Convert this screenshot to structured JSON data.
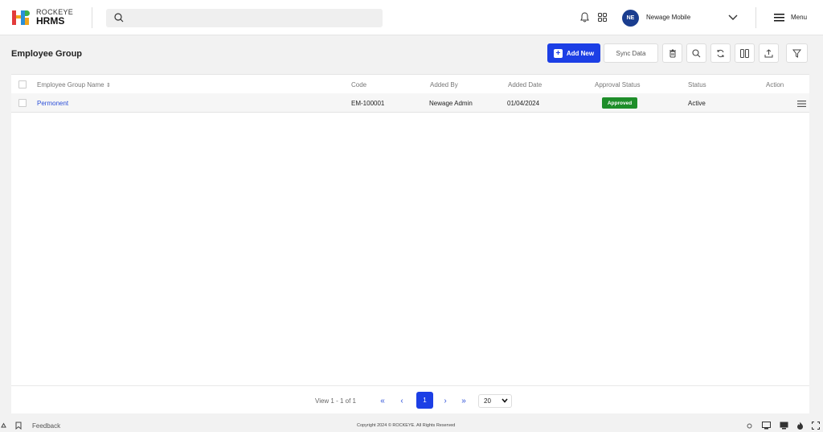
{
  "app": {
    "logo_top": "ROCKEYE",
    "logo_bottom": "HRMS"
  },
  "search": {
    "placeholder": "",
    "value": ""
  },
  "user": {
    "initials": "NE",
    "name": "Newage Mobile"
  },
  "menu": {
    "label": "Menu"
  },
  "page": {
    "title": "Employee Group",
    "add_new_label": "Add New",
    "sync_label": "Sync Data"
  },
  "table": {
    "columns": [
      "Employee Group Name",
      "Code",
      "Added By",
      "Added Date",
      "Approval Status",
      "Status",
      "Action"
    ],
    "sort_indicator": "⇕",
    "rows": [
      {
        "name": "Permonent",
        "code": "EM-100001",
        "added_by": "Newage Admin",
        "added_date": "01/04/2024",
        "approval_status": "Approved",
        "status": "Active"
      }
    ]
  },
  "pagination": {
    "view_text": "View 1 - 1 of 1",
    "first": "«",
    "prev": "‹",
    "current_page": "1",
    "next": "›",
    "last": "»",
    "page_size": "20"
  },
  "footer": {
    "feedback_label": "Feedback",
    "copyright": "Copyright 2024 © ROCKEYE. All Rights Reserved"
  },
  "colors": {
    "primary": "#1c3fe5",
    "link": "#2c4fd8",
    "approved": "#1e8e2a",
    "avatar": "#1a3d8f"
  }
}
